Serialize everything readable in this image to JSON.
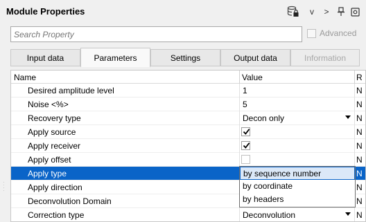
{
  "panel": {
    "title": "Module Properties",
    "menu_caret": "v",
    "nav_next": ">"
  },
  "search": {
    "placeholder": "Search Property"
  },
  "advanced": {
    "label": "Advanced"
  },
  "tabs": [
    {
      "label": "Input data",
      "state": "normal"
    },
    {
      "label": "Parameters",
      "state": "active"
    },
    {
      "label": "Settings",
      "state": "normal"
    },
    {
      "label": "Output data",
      "state": "normal"
    },
    {
      "label": "Information",
      "state": "disabled"
    }
  ],
  "grid": {
    "columns": {
      "name": "Name",
      "value": "Value",
      "extra": "R"
    },
    "rows": [
      {
        "name": "Desired amplitude level",
        "value": "1",
        "extra": "N"
      },
      {
        "name": "Noise <%>",
        "value": "5",
        "extra": "N"
      },
      {
        "name": "Recovery type",
        "value": "Decon only",
        "extra": "N"
      },
      {
        "name": "Apply source",
        "value": "",
        "extra": "N",
        "checked": true
      },
      {
        "name": "Apply receiver",
        "value": "",
        "extra": "N",
        "checked": true
      },
      {
        "name": "Apply offset",
        "value": "",
        "extra": "N",
        "checked": false
      },
      {
        "name": "Apply type",
        "value": "",
        "extra": "N"
      },
      {
        "name": "Apply direction",
        "value": "",
        "extra": "N"
      },
      {
        "name": "Deconvolution Domain",
        "value": "",
        "extra": "N"
      },
      {
        "name": "Correction type",
        "value": "Deconvolution",
        "extra": "N"
      }
    ]
  },
  "dropdown": {
    "options": [
      "by sequence number",
      "by coordinate",
      "by headers"
    ],
    "highlighted_index": 0
  },
  "colors": {
    "selection": "#0a64c8",
    "background": "#f0f0f0"
  }
}
